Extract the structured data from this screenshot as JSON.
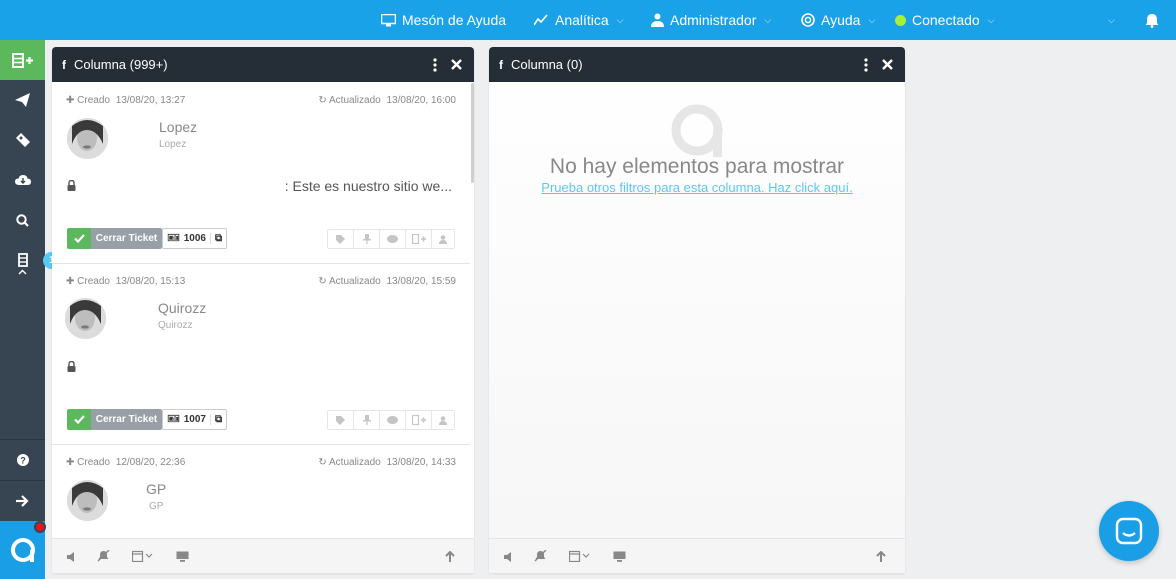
{
  "topbar": {
    "items": [
      {
        "label": "Mesón de Ayuda",
        "icon": "monitor-icon"
      },
      {
        "label": "Analítica",
        "icon": "chart-icon"
      },
      {
        "label": "Administrador",
        "icon": "user-tie-icon"
      },
      {
        "label": "Ayuda",
        "icon": "lifebuoy-icon"
      },
      {
        "label": "Conectado",
        "icon": "status-dot"
      }
    ]
  },
  "sidebar": {
    "badge": "1"
  },
  "columns": [
    {
      "title": "Columna (999+)",
      "tickets": [
        {
          "created_label": "Creado",
          "created": "13/08/20, 13:27",
          "updated_label": "Actualizado",
          "updated": "13/08/20, 16:00",
          "name": "Lopez",
          "username": "Lopez",
          "message": ": Este es nuestro sitio we...",
          "close_label": "Cerrar Ticket",
          "ticket_id": "1006"
        },
        {
          "created_label": "Creado",
          "created": "13/08/20, 15:13",
          "updated_label": "Actualizado",
          "updated": "13/08/20, 15:59",
          "name": "Quirozz",
          "username": "Quirozz",
          "message": "",
          "close_label": "Cerrar Ticket",
          "ticket_id": "1007"
        },
        {
          "created_label": "Creado",
          "created": "12/08/20, 22:36",
          "updated_label": "Actualizado",
          "updated": "13/08/20, 14:33",
          "name": "GP",
          "username": "GP"
        }
      ]
    },
    {
      "title": "Columna (0)",
      "empty_title": "No hay elementos para mostrar",
      "empty_link": "Prueba otros filtros para esta columna. Haz click aquí."
    }
  ],
  "colors": {
    "topbar": "#1aa2e8",
    "sidebar": "#374452",
    "accent_green": "#5cb85c",
    "column_header": "#252d36"
  }
}
